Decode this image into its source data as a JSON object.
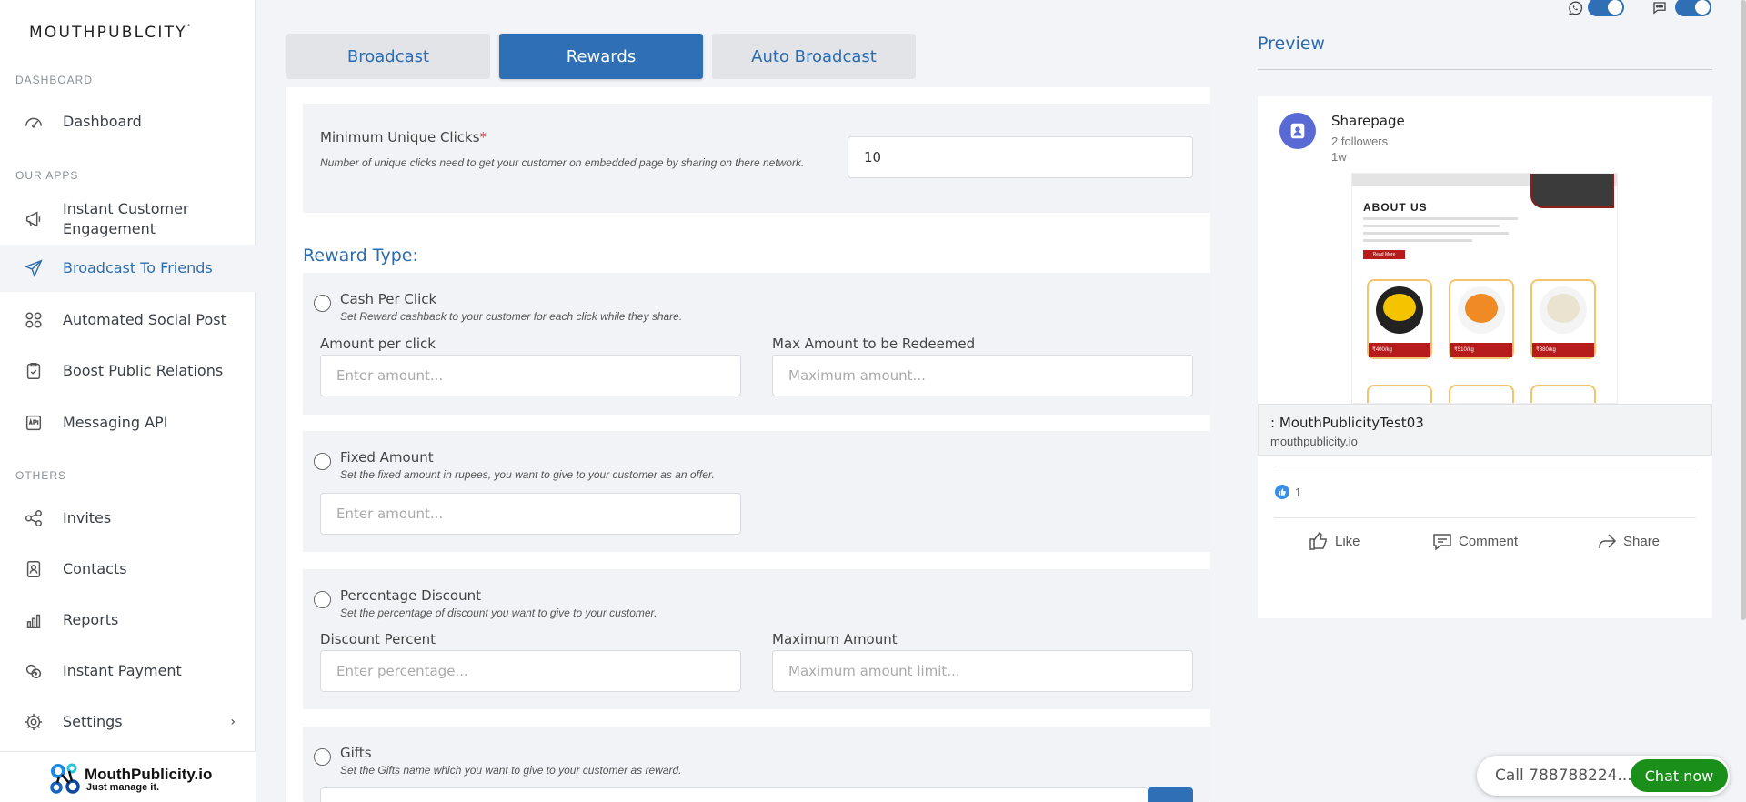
{
  "sidebar": {
    "brand": "MOUTHPUBLCITY",
    "brand_mark": "°",
    "sections": {
      "dashboard": "DASHBOARD",
      "apps": "OUR APPS",
      "others": "OTHERS"
    },
    "items": {
      "dashboard": "Dashboard",
      "ice_line1": "Instant Customer",
      "ice_line2": "Engagement",
      "broadcast": "Broadcast To Friends",
      "social": "Automated Social Post",
      "pr": "Boost Public Relations",
      "api": "Messaging API",
      "invites": "Invites",
      "contacts": "Contacts",
      "reports": "Reports",
      "payment": "Instant Payment",
      "settings": "Settings"
    },
    "footer": {
      "name": "MouthPublicity.io",
      "tagline": "Just manage it."
    }
  },
  "tabs": {
    "broadcast": "Broadcast",
    "rewards": "Rewards",
    "auto": "Auto Broadcast"
  },
  "min_clicks": {
    "label": "Minimum Unique Clicks",
    "required": "*",
    "hint": "Number of unique clicks need to get your customer on embedded page by sharing on there network.",
    "value": "10"
  },
  "reward_type": {
    "title": "Reward Type:",
    "cash": {
      "label": "Cash Per Click",
      "hint": "Set Reward cashback to your customer for each click while they share.",
      "amount_label": "Amount per click",
      "amount_placeholder": "Enter amount...",
      "max_label": "Max Amount to be Redeemed",
      "max_placeholder": "Maximum amount..."
    },
    "fixed": {
      "label": "Fixed Amount",
      "hint": "Set the fixed amount in rupees, you want to give to your customer as an offer.",
      "amount_placeholder": "Enter amount..."
    },
    "percent": {
      "label": "Percentage Discount",
      "hint": "Set the percentage of discount you want to give to your customer.",
      "discount_label": "Discount Percent",
      "discount_placeholder": "Enter percentage...",
      "max_label": "Maximum Amount",
      "max_placeholder": "Maximum amount limit..."
    },
    "gifts": {
      "label": "Gifts",
      "hint": "Set the Gifts name which you want to give to your customer as reward."
    }
  },
  "preview": {
    "title": "Preview",
    "page_name": "Sharepage",
    "followers": "2 followers",
    "age": "1w",
    "image": {
      "heading": "ABOUT US",
      "button": "Read More",
      "prices": [
        "₹400/kg",
        "₹510/kg",
        "₹380/kg"
      ]
    },
    "link_title": ": MouthPublicityTest03",
    "link_domain": "mouthpublicity.io",
    "reactions": "1",
    "actions": {
      "like": "Like",
      "comment": "Comment",
      "share": "Share"
    }
  },
  "chat": {
    "call": "Call 788788224...",
    "button": "Chat now"
  },
  "colors": {
    "accent": "#2f6fb5",
    "link": "#2b6cb0",
    "chat_green": "#1a8f1a",
    "avatar": "#5a6ad4"
  }
}
